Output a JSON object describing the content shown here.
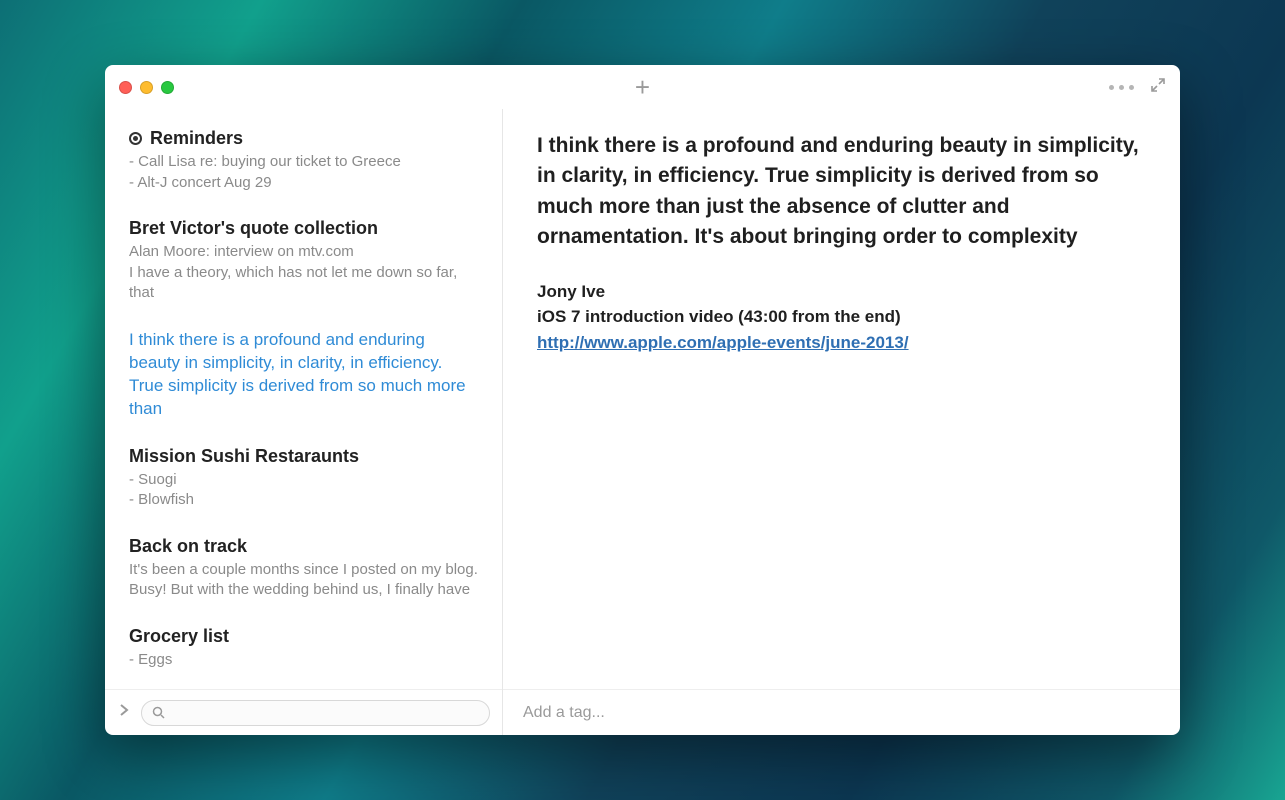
{
  "titlebar": {
    "plus_glyph": "+"
  },
  "sidebar": {
    "notes": [
      {
        "has_bullet": true,
        "title": "Reminders",
        "preview": "- Call Lisa re: buying our ticket to Greece\n- Alt-J concert Aug 29",
        "selected": false
      },
      {
        "has_bullet": false,
        "title": "Bret Victor's quote collection",
        "preview": "Alan Moore: interview on mtv.com\nI have a theory, which has not let me down so far, that",
        "selected": false
      },
      {
        "has_bullet": false,
        "title": "",
        "preview": "I think there is a profound and enduring beauty in simplicity, in clarity, in efficiency. True simplicity is derived from so much more than",
        "selected": true
      },
      {
        "has_bullet": false,
        "title": "Mission Sushi Restaraunts",
        "preview": "- Suogi\n- Blowfish",
        "selected": false
      },
      {
        "has_bullet": false,
        "title": "Back on track",
        "preview": "It's been a couple months since I posted on my blog. Busy! But with the wedding behind us, I finally have",
        "selected": false
      },
      {
        "has_bullet": false,
        "title": "Grocery list",
        "preview": "- Eggs",
        "selected": false
      }
    ],
    "search_placeholder": ""
  },
  "editor": {
    "paragraph": "I think there is a profound and enduring beauty in simplicity, in clarity, in efficiency. True simplicity is derived from so much more than just the absence of clutter and ornamentation. It's about bringing order to complexity",
    "author": "Jony Ive",
    "source": "iOS 7 introduction video (43:00 from the end)",
    "link_text": "http://www.apple.com/apple-events/june-2013/",
    "link_href": "http://www.apple.com/apple-events/june-2013/",
    "tag_placeholder": "Add a tag..."
  }
}
